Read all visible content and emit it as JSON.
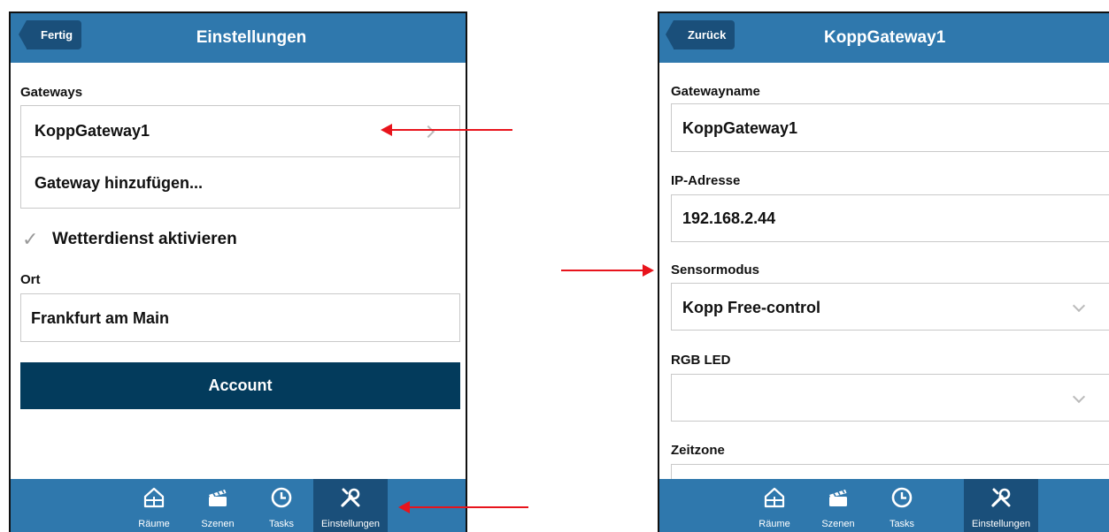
{
  "left_screen": {
    "back_label": "Fertig",
    "title": "Einstellungen",
    "gateways_label": "Gateways",
    "gateway_items": [
      "KoppGateway1",
      "Gateway hinzufügen..."
    ],
    "weather_label": "Wetterdienst aktivieren",
    "weather_checked": true,
    "ort_label": "Ort",
    "ort_value": "Frankfurt am Main",
    "account_label": "Account"
  },
  "right_screen": {
    "back_label": "Zurück",
    "title": "KoppGateway1",
    "gatewayname_label": "Gatewayname",
    "gatewayname_value": "KoppGateway1",
    "ip_label": "IP-Adresse",
    "ip_value": "192.168.2.44",
    "sensormodus_label": "Sensormodus",
    "sensormodus_value": "Kopp Free-control",
    "rgb_label": "RGB LED",
    "rgb_value": "",
    "zeitzone_label": "Zeitzone"
  },
  "tabbar": {
    "tabs": [
      {
        "label": "Räume",
        "icon": "house-icon"
      },
      {
        "label": "Szenen",
        "icon": "clapperboard-icon"
      },
      {
        "label": "Tasks",
        "icon": "clock-icon"
      },
      {
        "label": "Einstellungen",
        "icon": "tools-icon"
      }
    ],
    "active": "Einstellungen"
  },
  "colors": {
    "header": "#2f78ad",
    "header_dark": "#1a4f7a",
    "account_button": "#033b5c",
    "annotation_arrow": "#e8141c"
  }
}
